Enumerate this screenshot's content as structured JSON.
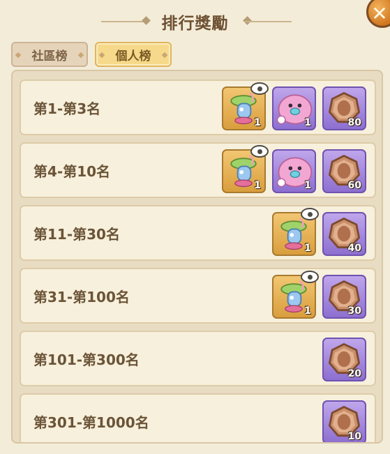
{
  "header": {
    "title": "排行獎勵",
    "close_icon": "close-x-icon"
  },
  "tabs": [
    {
      "label": "社區榜",
      "active": false
    },
    {
      "label": "個人榜",
      "active": true
    }
  ],
  "rows": [
    {
      "label": "第1-第3名",
      "items": [
        {
          "type": "gift-set",
          "qty": "1",
          "has_preview": true,
          "frame": "gold"
        },
        {
          "type": "seal-plush",
          "qty": "1",
          "has_preview": false,
          "frame": "purple"
        },
        {
          "type": "bronze-medal",
          "qty": "80",
          "has_preview": false,
          "frame": "purple"
        }
      ]
    },
    {
      "label": "第4-第10名",
      "items": [
        {
          "type": "gift-set",
          "qty": "1",
          "has_preview": true,
          "frame": "gold"
        },
        {
          "type": "seal-plush",
          "qty": "1",
          "has_preview": false,
          "frame": "purple"
        },
        {
          "type": "bronze-medal",
          "qty": "60",
          "has_preview": false,
          "frame": "purple"
        }
      ]
    },
    {
      "label": "第11-第30名",
      "items": [
        {
          "type": "gift-set",
          "qty": "1",
          "has_preview": true,
          "frame": "gold"
        },
        {
          "type": "bronze-medal",
          "qty": "40",
          "has_preview": false,
          "frame": "purple"
        }
      ]
    },
    {
      "label": "第31-第100名",
      "items": [
        {
          "type": "gift-set",
          "qty": "1",
          "has_preview": true,
          "frame": "gold"
        },
        {
          "type": "bronze-medal",
          "qty": "30",
          "has_preview": false,
          "frame": "purple"
        }
      ]
    },
    {
      "label": "第101-第300名",
      "items": [
        {
          "type": "bronze-medal",
          "qty": "20",
          "has_preview": false,
          "frame": "purple"
        }
      ]
    },
    {
      "label": "第301-第1000名",
      "items": [
        {
          "type": "bronze-medal",
          "qty": "10",
          "has_preview": false,
          "frame": "purple"
        }
      ]
    }
  ],
  "colors": {
    "background": "#f3ecd9",
    "accent_gold": "#f6d98a",
    "frame_purple": "#8d6fd0",
    "close_orange": "#d0751f"
  }
}
